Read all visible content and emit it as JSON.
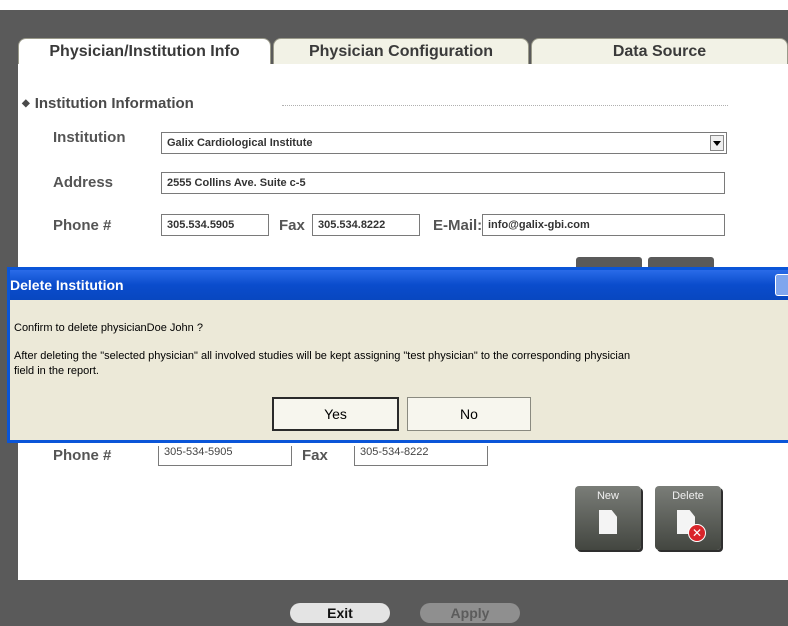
{
  "tabs": [
    {
      "label": "Physician/Institution Info",
      "active": true
    },
    {
      "label": "Physician Configuration",
      "active": false
    },
    {
      "label": "Data Source",
      "active": false
    }
  ],
  "institution_section": {
    "title": "Institution Information",
    "institution_label": "Institution",
    "institution_value": "Galix Cardiological Institute",
    "address_label": "Address",
    "address_value": "2555 Collins Ave. Suite c-5",
    "phone_label": "Phone #",
    "phone_value": "305.534.5905",
    "fax_label": "Fax",
    "fax_value": "305.534.8222",
    "email_label": "E-Mail:",
    "email_value": "info@galix-gbi.com"
  },
  "physician_section": {
    "phone_label": "Phone #",
    "phone_value": "305-534-5905",
    "fax_label": "Fax",
    "fax_value": "305-534-8222",
    "new_label": "New",
    "delete_label": "Delete"
  },
  "footer": {
    "exit_label": "Exit",
    "apply_label": "Apply"
  },
  "dialog": {
    "title": "Delete Institution",
    "confirm_text": "Confirm to delete physicianDoe John ?",
    "info_line1": "After deleting the \"selected physician\" all involved studies will be kept assigning \"test physician\" to the corresponding physician",
    "info_line2": "field in the report.",
    "yes_label": "Yes",
    "no_label": "No"
  },
  "colors": {
    "dialog_title_bar": "#0a4ccc",
    "dialog_body": "#ece9d8",
    "frame": "#5a5a5a",
    "delete_badge": "#d9242a"
  }
}
